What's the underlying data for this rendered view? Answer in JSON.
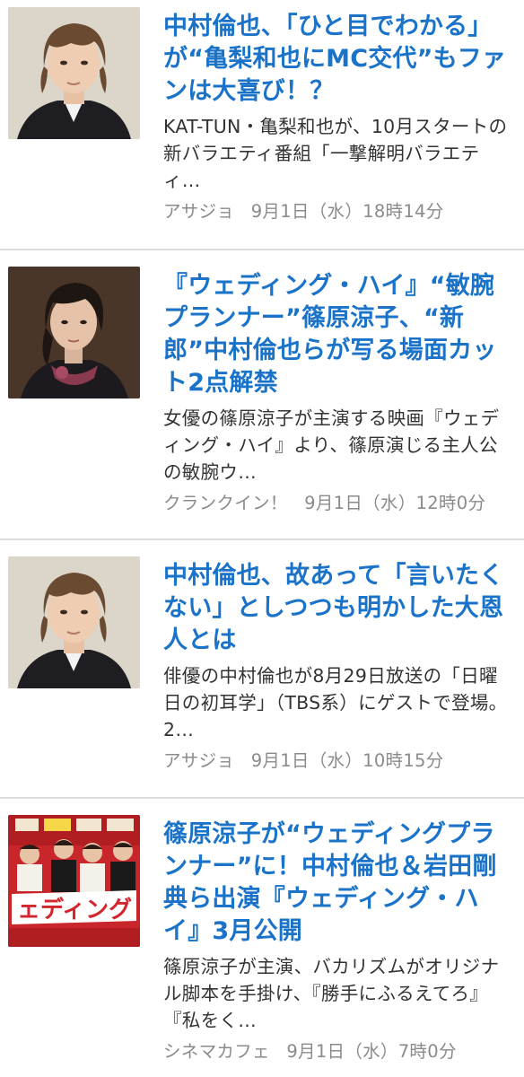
{
  "articles": [
    {
      "title": "中村倫也、「ひと目でわかる」が“亀梨和也にMC交代”もファンは大喜び！？",
      "summary": "KAT-TUN・亀梨和也が、10月スタートの新バラエティ番組「一撃解明バラエティ…",
      "source": "アサジョ",
      "date": "9月1日（水）18時14分",
      "thumbnail": "portrait-man-icon"
    },
    {
      "title": "『ウェディング・ハイ』“敏腕プランナー”篠原涼子、“新郎”中村倫也らが写る場面カット2点解禁",
      "summary": "女優の篠原涼子が主演する映画『ウェディング・ハイ』より、篠原演じる主人公の敏腕ウ…",
      "source": "クランクイン！",
      "date": "9月1日（水）12時0分",
      "thumbnail": "portrait-woman-icon"
    },
    {
      "title": "中村倫也、故あって「言いたくない」としつつも明かした大恩人とは",
      "summary": "俳優の中村倫也が8月29日放送の「日曜日の初耳学」（TBS系）にゲストで登場。2…",
      "source": "アサジョ",
      "date": "9月1日（水）10時15分",
      "thumbnail": "portrait-man-icon"
    },
    {
      "title": "篠原涼子が“ウェディングプランナー”に！中村倫也＆岩田剛典ら出演『ウェディング・ハイ』3月公開",
      "summary": "篠原涼子が主演、バカリズムがオリジナル脚本を手掛け、『勝手にふるえてろ』『私をく…",
      "source": "シネマカフェ",
      "date": "9月1日（水）7時0分",
      "thumbnail": "movie-poster-icon"
    }
  ],
  "colors": {
    "title": "#1a73c9",
    "summary": "#333333",
    "meta": "#8b8b8b",
    "divider": "#dcdcdc"
  }
}
